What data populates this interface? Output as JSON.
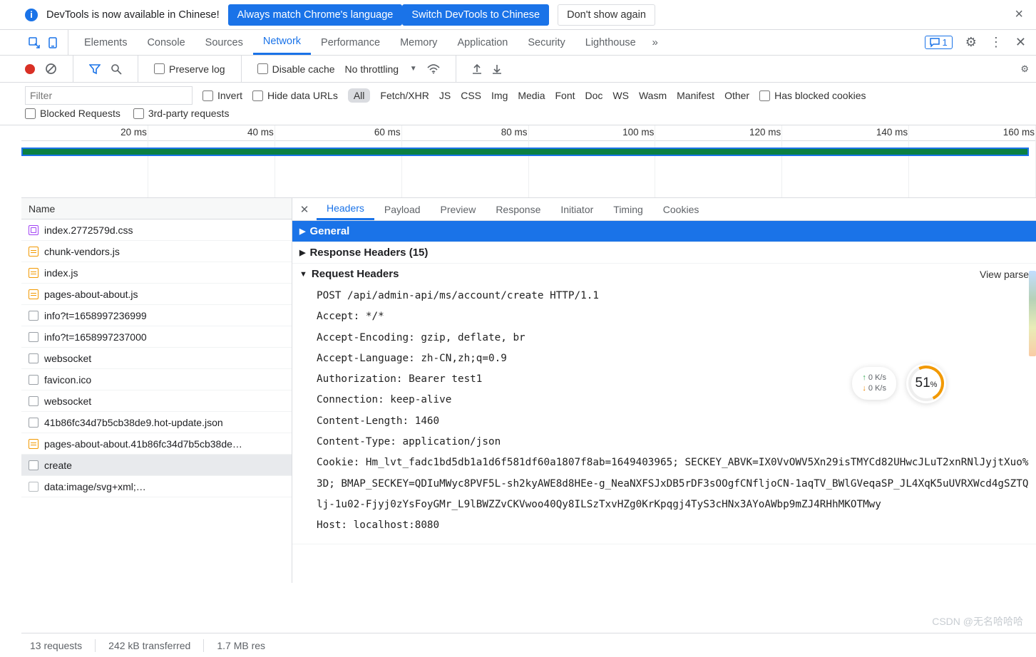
{
  "messageBar": {
    "text": "DevTools is now available in Chinese!",
    "buttons": {
      "match": "Always match Chrome's language",
      "switch": "Switch DevTools to Chinese",
      "dont": "Don't show again"
    }
  },
  "tabs": [
    "Elements",
    "Console",
    "Sources",
    "Network",
    "Performance",
    "Memory",
    "Application",
    "Security",
    "Lighthouse"
  ],
  "activeTab": "Network",
  "issuesBadge": "1",
  "toolbar": {
    "preserveLog": "Preserve log",
    "disableCache": "Disable cache",
    "throttling": "No throttling"
  },
  "filterRow": {
    "placeholder": "Filter",
    "invert": "Invert",
    "hideDataUrls": "Hide data URLs",
    "types": [
      "All",
      "Fetch/XHR",
      "JS",
      "CSS",
      "Img",
      "Media",
      "Font",
      "Doc",
      "WS",
      "Wasm",
      "Manifest",
      "Other"
    ],
    "activeType": "All",
    "hasBlockedCookies": "Has blocked cookies",
    "blockedRequests": "Blocked Requests",
    "thirdParty": "3rd-party requests"
  },
  "timeline": {
    "ticks": [
      "20 ms",
      "40 ms",
      "60 ms",
      "80 ms",
      "100 ms",
      "120 ms",
      "140 ms",
      "160 ms"
    ]
  },
  "requestsHeader": "Name",
  "requests": [
    {
      "icon": "css",
      "name": "index.2772579d.css"
    },
    {
      "icon": "js",
      "name": "chunk-vendors.js"
    },
    {
      "icon": "js",
      "name": "index.js"
    },
    {
      "icon": "js",
      "name": "pages-about-about.js"
    },
    {
      "icon": "doc",
      "name": "info?t=1658997236999"
    },
    {
      "icon": "doc",
      "name": "info?t=1658997237000"
    },
    {
      "icon": "doc",
      "name": "websocket"
    },
    {
      "icon": "doc",
      "name": "favicon.ico"
    },
    {
      "icon": "doc",
      "name": "websocket"
    },
    {
      "icon": "doc",
      "name": "41b86fc34d7b5cb38de9.hot-update.json"
    },
    {
      "icon": "js",
      "name": "pages-about-about.41b86fc34d7b5cb38de…"
    },
    {
      "icon": "doc",
      "name": "create",
      "selected": true
    },
    {
      "icon": "other",
      "name": "data:image/svg+xml;…"
    }
  ],
  "detailTabs": [
    "Headers",
    "Payload",
    "Preview",
    "Response",
    "Initiator",
    "Timing",
    "Cookies"
  ],
  "activeDetailTab": "Headers",
  "sections": {
    "general": "General",
    "responseHeaders": "Response Headers (15)",
    "requestHeaders": "Request Headers",
    "viewParsed": "View parse"
  },
  "requestHeaderLines": [
    "POST /api/admin-api/ms/account/create HTTP/1.1",
    "Accept: */*",
    "Accept-Encoding: gzip, deflate, br",
    "Accept-Language: zh-CN,zh;q=0.9",
    "Authorization: Bearer test1",
    "Connection: keep-alive",
    "Content-Length: 1460",
    "Content-Type: application/json",
    "Cookie: Hm_lvt_fadc1bd5db1a1d6f581df60a1807f8ab=1649403965; SECKEY_ABVK=IX0VvOWV5Xn29isTMYCd82UHwcJLuT2xnRNlJyjtXuo%3D; BMAP_SECKEY=QDIuMWyc8PVF5L-sh2kyAWE8d8HEe-g_NeaNXFSJxDB5rDF3sOOgfCNfljoCN-1aqTV_BWlGVeqaSP_JL4XqK5uUVRXWcd4gSZTQlj-1u02-Fjyj0zYsFoyGMr_L9lBWZZvCKVwoo40Qy8ILSzTxvHZg0KrKpqgj4TyS3cHNx3AYoAWbp9mZJ4RHhMKOTMwy",
    "Host: localhost:8080"
  ],
  "status": {
    "requests": "13 requests",
    "transferred": "242 kB transferred",
    "resources": "1.7 MB res"
  },
  "widget": {
    "up": "0  K/s",
    "down": "0  K/s",
    "percent": "51",
    "unit": "%"
  },
  "watermark": "CSDN @无名哈哈哈"
}
